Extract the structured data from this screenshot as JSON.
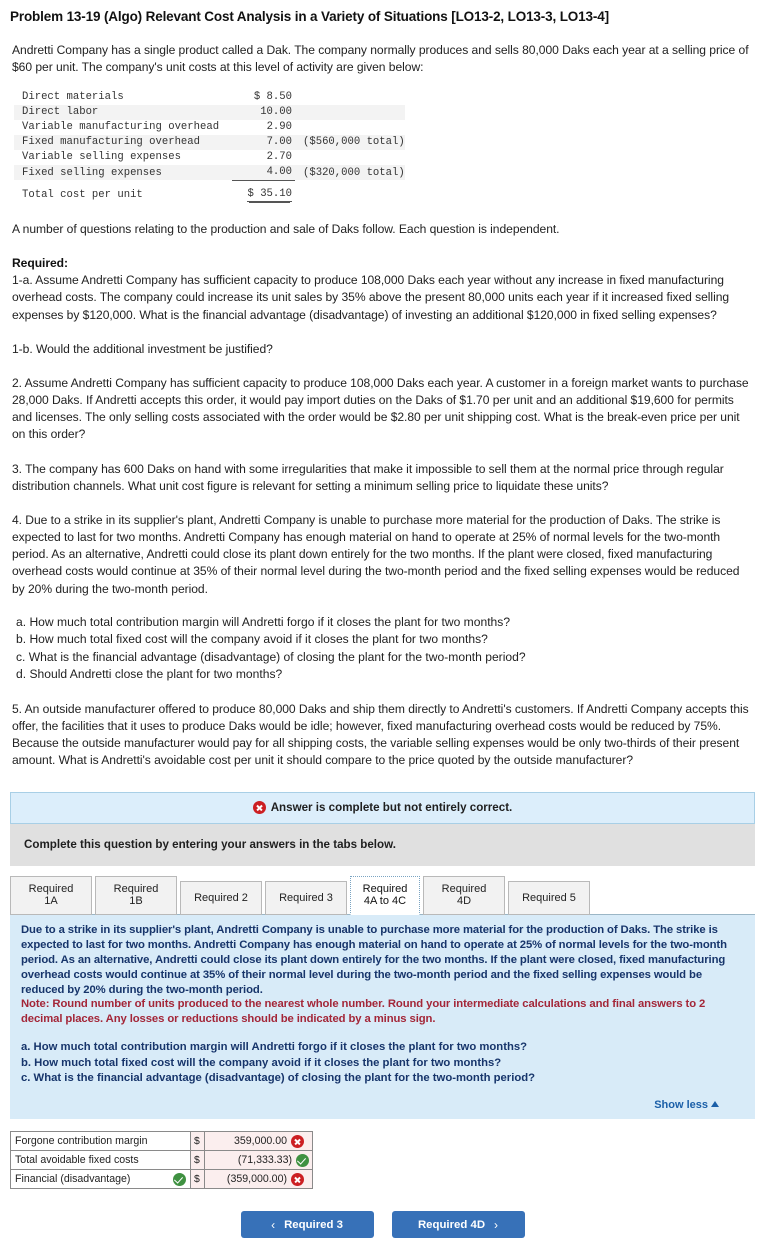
{
  "title": "Problem 13-19 (Algo) Relevant Cost Analysis in a Variety of Situations [LO13-2, LO13-3, LO13-4]",
  "intro": "Andretti Company has a single product called a Dak. The company normally produces and sells 80,000 Daks each year at a selling price of $60 per unit. The company's unit costs at this level of activity are given below:",
  "cost_table": {
    "rows": [
      {
        "label": "Direct materials",
        "amount": "$ 8.50",
        "note": ""
      },
      {
        "label": "Direct labor",
        "amount": "10.00",
        "note": ""
      },
      {
        "label": "Variable manufacturing overhead",
        "amount": "2.90",
        "note": ""
      },
      {
        "label": "Fixed manufacturing overhead",
        "amount": "7.00",
        "note": "($560,000 total)"
      },
      {
        "label": "Variable selling expenses",
        "amount": "2.70",
        "note": ""
      },
      {
        "label": "Fixed selling expenses",
        "amount": "4.00",
        "note": "($320,000 total)"
      }
    ],
    "total_label": "Total cost per unit",
    "total_amount": "$ 35.10"
  },
  "independent_note": "A number of questions relating to the production and sale of Daks follow. Each question is independent.",
  "required_heading": "Required:",
  "q1a": "1-a. Assume Andretti Company has sufficient capacity to produce 108,000 Daks each year without any increase in fixed manufacturing overhead costs. The company could increase its unit sales by 35% above the present 80,000 units each year if it increased fixed selling expenses by $120,000. What is the financial advantage (disadvantage) of investing an additional $120,000 in fixed selling expenses?",
  "q1b": "1-b. Would the additional investment be justified?",
  "q2": "2. Assume Andretti Company has sufficient capacity to produce 108,000 Daks each year. A customer in a foreign market wants to purchase 28,000 Daks. If Andretti accepts this order, it would pay import duties on the Daks of $1.70 per unit and an additional $19,600 for permits and licenses. The only selling costs associated with the order would be $2.80 per unit shipping cost. What is the break-even price per unit on this order?",
  "q3": "3. The company has 600 Daks on hand with some irregularities that make it impossible to sell them at the normal price through regular distribution channels. What unit cost figure is relevant for setting a minimum selling price to liquidate these units?",
  "q4": "4. Due to a strike in its supplier's plant, Andretti Company is unable to purchase more material for the production of Daks. The strike is expected to last for two months. Andretti Company has enough material on hand to operate at 25% of normal levels for the two-month period. As an alternative, Andretti could close its plant down entirely for the two months. If the plant were closed, fixed manufacturing overhead costs would continue at 35% of their normal level during the two-month period and the fixed selling expenses would be reduced by 20% during the two-month period.",
  "q4_subs": [
    "a. How much total contribution margin will Andretti forgo if it closes the plant for two months?",
    "b. How much total fixed cost will the company avoid if it closes the plant for two months?",
    "c. What is the financial advantage (disadvantage) of closing the plant for the two-month period?",
    "d. Should Andretti close the plant for two months?"
  ],
  "q5": "5. An outside manufacturer offered to produce 80,000 Daks and ship them directly to Andretti's customers. If Andretti Company accepts this offer, the facilities that it uses to produce Daks would be idle; however, fixed manufacturing overhead costs would be reduced by 75%. Because the outside manufacturer would pay for all shipping costs, the variable selling expenses would be only two-thirds of their present amount. What is Andretti's avoidable cost per unit it should compare to the price quoted by the outside manufacturer?",
  "alert": {
    "text": "Answer is complete but not entirely correct.",
    "icon": "x-circle-icon"
  },
  "instruction": "Complete this question by entering your answers in the tabs below.",
  "tabs": [
    {
      "label": "Required 1A",
      "active": false
    },
    {
      "label": "Required 1B",
      "active": false
    },
    {
      "label": "Required 2",
      "active": false
    },
    {
      "label": "Required 3",
      "active": false
    },
    {
      "label": "Required 4A to 4C",
      "active": true
    },
    {
      "label": "Required 4D",
      "active": false
    },
    {
      "label": "Required 5",
      "active": false
    }
  ],
  "panel": {
    "prompt": "Due to a strike in its supplier's plant, Andretti Company is unable to purchase more material for the production of Daks. The strike is expected to last for two months. Andretti Company has enough material on hand to operate at 25% of normal levels for the two-month period. As an alternative, Andretti could close its plant down entirely for the two months. If the plant were closed, fixed manufacturing overhead costs would continue at 35% of their normal level during the two-month period and the fixed selling expenses would be reduced by 20% during the two-month period.",
    "note": "Note: Round number of units produced to the nearest whole number. Round your intermediate calculations and final answers to 2 decimal places. Any losses or reductions should be indicated by a minus sign.",
    "questions": [
      "a. How much total contribution margin will Andretti forgo if it closes the plant for two months?",
      "b. How much total fixed cost will the company avoid if it closes the plant for two months?",
      "c. What is the financial advantage (disadvantage) of closing the plant for the two-month period?"
    ],
    "show_less_label": "Show less"
  },
  "answers": {
    "currency_symbol": "$",
    "rows": [
      {
        "label": "Forgone contribution margin",
        "label_status": "",
        "value": "359,000.00",
        "value_status": "incorrect"
      },
      {
        "label": "Total avoidable fixed costs",
        "label_status": "",
        "value": "(71,333.33)",
        "value_status": "correct"
      },
      {
        "label": "Financial (disadvantage)",
        "label_status": "correct",
        "value": "(359,000.00)",
        "value_status": "incorrect"
      }
    ]
  },
  "nav": {
    "prev_label": "Required 3",
    "next_label": "Required 4D",
    "prev_chevron": "‹",
    "next_chevron": "›"
  },
  "colors": {
    "accent_blue": "#3771b8",
    "panel_blue": "#d8ebf8",
    "alert_blue": "#dceefb",
    "note_red": "#a32638",
    "incorrect_red": "#cc1f23",
    "correct_green": "#3f9141"
  }
}
